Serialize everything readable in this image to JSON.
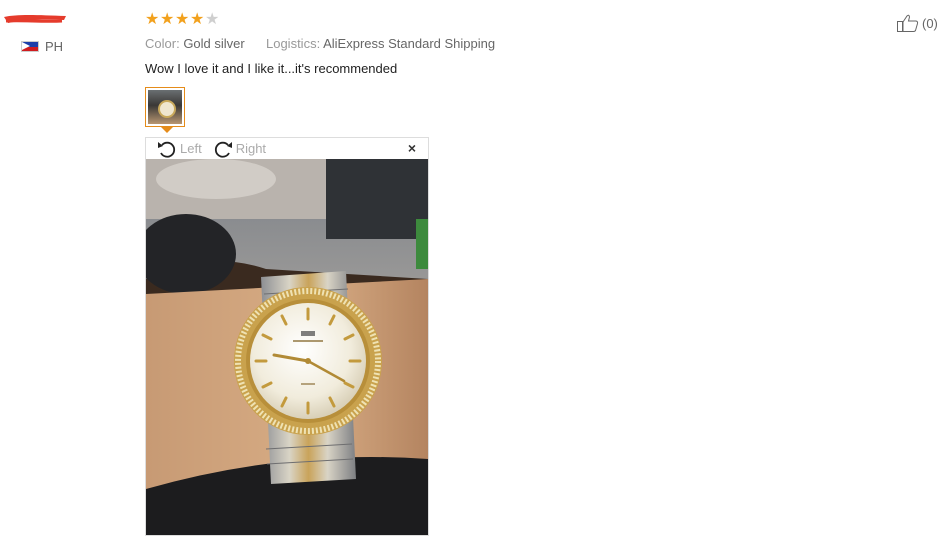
{
  "reviewer": {
    "country_code": "PH"
  },
  "rating": {
    "value": 4,
    "max": 5
  },
  "attributes": {
    "color_label": "Color:",
    "color_value": "Gold silver",
    "logistics_label": "Logistics:",
    "logistics_value": "AliExpress Standard Shipping"
  },
  "review": {
    "text": "Wow I love it and I like it...it's recommended"
  },
  "viewer": {
    "rotate_left_label": "Left",
    "rotate_right_label": "Right",
    "close_label": "×"
  },
  "helpful": {
    "count_text": "(0)"
  },
  "colors": {
    "star_on": "#f2a11d",
    "star_off": "#cfcfcf",
    "thumb_border": "#e58c1a",
    "redaction": "#e53b2c"
  },
  "icons": [
    "philippines-flag-icon",
    "star-icon",
    "rotate-left-icon",
    "rotate-right-icon",
    "close-icon",
    "thumbs-up-icon"
  ]
}
